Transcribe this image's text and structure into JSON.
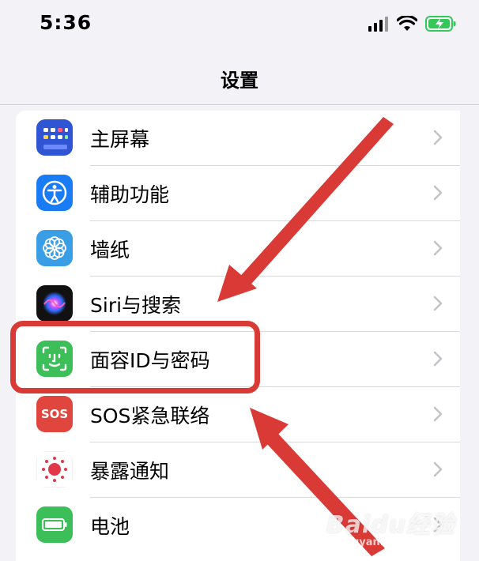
{
  "status_bar": {
    "time": "5:36"
  },
  "nav": {
    "title": "设置"
  },
  "settings": {
    "items": [
      {
        "label": "主屏幕",
        "icon": "home-screen-icon"
      },
      {
        "label": "辅助功能",
        "icon": "accessibility-icon"
      },
      {
        "label": "墙纸",
        "icon": "wallpaper-icon"
      },
      {
        "label": "Siri与搜索",
        "icon": "siri-icon"
      },
      {
        "label": "面容ID与密码",
        "icon": "face-id-icon"
      },
      {
        "label": "SOS紧急联络",
        "icon": "sos-icon",
        "icon_text": "SOS"
      },
      {
        "label": "暴露通知",
        "icon": "exposure-notification-icon"
      },
      {
        "label": "电池",
        "icon": "battery-icon"
      }
    ]
  },
  "annotation": {
    "highlight_color": "#d93a36"
  },
  "watermark": {
    "text": "Baidu经验",
    "sub": "jingyan.baidu.com"
  }
}
